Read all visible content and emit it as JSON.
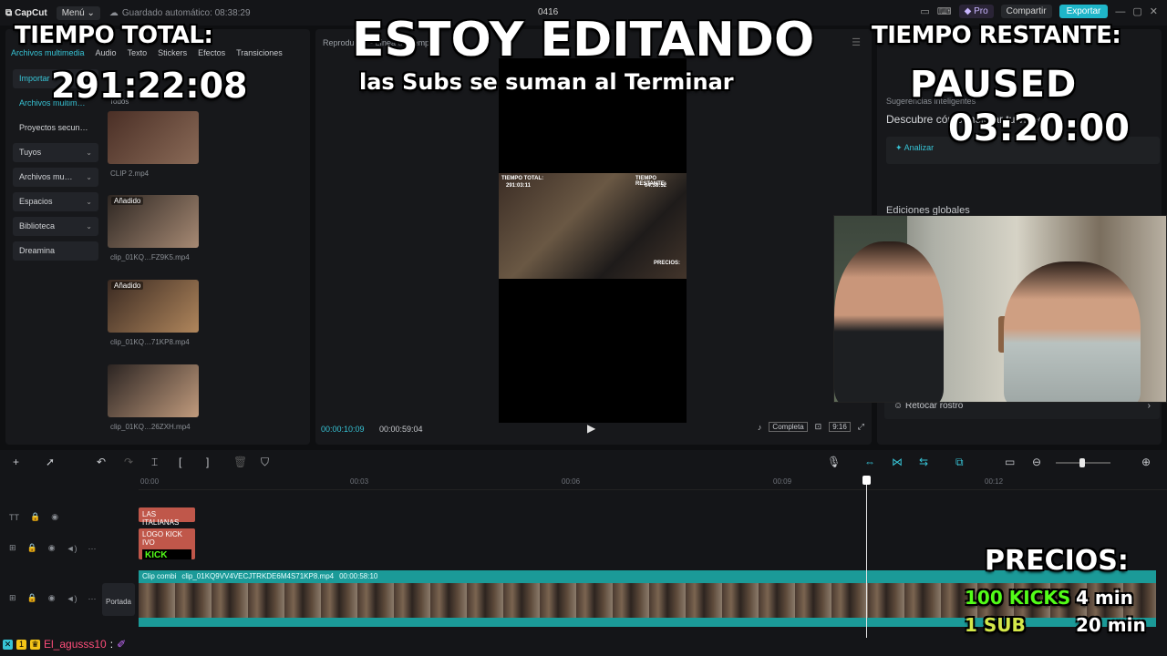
{
  "topbar": {
    "app_name": "CapCut",
    "menu_label": "Menú",
    "autosave": "Guardado automático: 08:38:29",
    "project_name": "0416",
    "pro_label": "Pro",
    "share_label": "Compartir",
    "export_label": "Exportar"
  },
  "left_panel": {
    "tabs": [
      "Archivos multimedia",
      "Audio",
      "Texto",
      "Stickers",
      "Efectos",
      "Transiciones"
    ],
    "nav": [
      {
        "label": "Importar",
        "chevron": false
      },
      {
        "label": "Archivos multim…",
        "chevron": false
      },
      {
        "label": "Proyectos secun…",
        "chevron": false
      },
      {
        "label": "Tuyos",
        "chevron": true
      },
      {
        "label": "Archivos mu…",
        "chevron": true
      },
      {
        "label": "Espacios",
        "chevron": true
      },
      {
        "label": "Biblioteca",
        "chevron": true
      },
      {
        "label": "Dreamina",
        "chevron": false
      }
    ],
    "section_label": "Todos",
    "media": [
      {
        "badge": "",
        "name": "CLIP 2.mp4",
        "colors": "#4a2f26,#8a6a57"
      },
      {
        "badge": "Añadido",
        "name": "clip_01KQ…FZ9K5.mp4",
        "colors": "#2d2622,#a78a74"
      },
      {
        "badge": "Añadido",
        "name": "clip_01KQ…71KP8.mp4",
        "colors": "#3a2a22,#b0865c"
      },
      {
        "badge": "",
        "name": "clip_01KQ…26ZXH.mp4",
        "colors": "#2b2422,#c19b7d"
      }
    ]
  },
  "viewer": {
    "header": "Reproductor - Línea de tiempo",
    "current_time": "00:00:10:09",
    "total_time": "00:00:59:04",
    "complete_label": "Completa",
    "ratio_label": "9:16",
    "mini_overlay": {
      "left_title": "TIEMPO TOTAL:",
      "left_time": "291:03:11",
      "right_title": "TIEMPO RESTANTE:",
      "right_time": "04:38:52",
      "prices": "PRECIOS:"
    }
  },
  "right_panel": {
    "suggestions": "Sugerencias inteligentes",
    "description": "Descubre cómo mejorar tu video",
    "analyze": "Analizar",
    "global_edits": "Ediciones globales",
    "retouch": "Retocar rostro"
  },
  "timeline": {
    "ruler": [
      "00:00",
      "00:03",
      "00:06",
      "00:09",
      "00:12"
    ],
    "text_clip": "LAS ITALIANAS",
    "sticker_clip": "LOGO KICK IVO",
    "sticker_kick": "KICK",
    "cover_label": "Portada",
    "main_clip_tag": "Clip combi",
    "main_clip_name": "clip_01KQ9VV4VECJTRKDE6M4S71KP8.mp4",
    "main_clip_duration": "00:00:58:10"
  },
  "chat": {
    "username": "El_agusss10",
    "separator": ":"
  },
  "overlay": {
    "left_title": "TIEMPO TOTAL:",
    "left_time": "291:22:08",
    "center_title": "ESTOY EDITANDO",
    "center_sub": "las Subs se suman al Terminar",
    "right_title": "TIEMPO RESTANTE:",
    "right_status": "PAUSED",
    "right_time": "03:20:00",
    "prices_title": "PRECIOS:",
    "price_rows": [
      {
        "item": "100 KICKS",
        "time": "4 min"
      },
      {
        "item": "1 SUB",
        "time": "20 min"
      }
    ]
  },
  "colors": {
    "accent": "#37c3d5",
    "export": "#1fb6c9",
    "clip_red": "#c0574a",
    "clip_teal": "#1b9a98",
    "kick_green": "#53fc18"
  }
}
